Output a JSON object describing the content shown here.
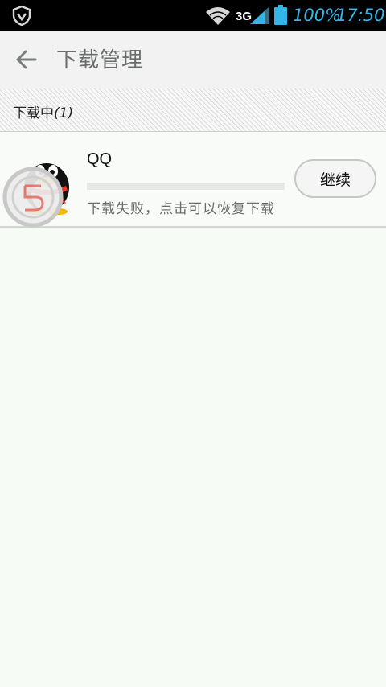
{
  "status_bar": {
    "network_type": "3G",
    "battery_percent": "100%",
    "time": "17:50",
    "accent_color": "#33b5e5",
    "icons": [
      "shield-icon",
      "wifi-icon",
      "signal-icon",
      "battery-icon"
    ]
  },
  "action_bar": {
    "title": "下载管理",
    "back_icon": "back-arrow-icon"
  },
  "section": {
    "label": "下载中",
    "count": "(1)"
  },
  "downloads": [
    {
      "name": "QQ",
      "icon": "qq-penguin-icon",
      "progress": 0,
      "status": "下载失败，点击可以恢复下载",
      "action_label": "继续"
    }
  ],
  "overlay": {
    "icon": "floating-assistant-icon"
  }
}
